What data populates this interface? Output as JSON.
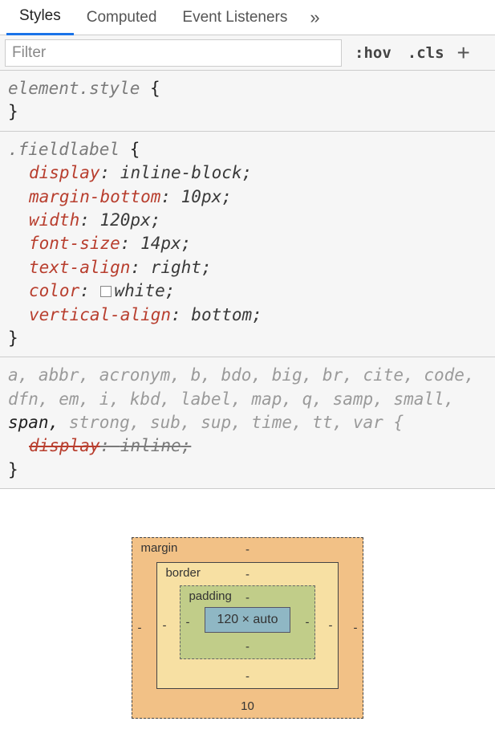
{
  "tabs": {
    "styles": "Styles",
    "computed": "Computed",
    "listeners": "Event Listeners"
  },
  "toolbar": {
    "filter_placeholder": "Filter",
    "hov": ":hov",
    "cls": ".cls"
  },
  "overflow_glyph": "»",
  "rule_element_style": {
    "selector": "element.style",
    "open": " {",
    "close": "}"
  },
  "rule_fieldlabel": {
    "selector": ".fieldlabel",
    "open": " {",
    "close": "}",
    "decls": [
      {
        "prop": "display",
        "val": "inline-block"
      },
      {
        "prop": "margin-bottom",
        "val": "10px"
      },
      {
        "prop": "width",
        "val": "120px"
      },
      {
        "prop": "font-size",
        "val": "14px"
      },
      {
        "prop": "text-align",
        "val": "right"
      },
      {
        "prop": "color",
        "val": "white",
        "swatch": true
      },
      {
        "prop": "vertical-align",
        "val": "bottom"
      }
    ]
  },
  "rule_ua": {
    "selectors_pre": "a, abbr, acronym, b, bdo, big, br, cite, code, dfn, em, i, kbd, label, map, q, samp, small, ",
    "matched": "span,",
    "selectors_post": " strong, sub, sup, time, tt, var {",
    "decl": {
      "prop": "display",
      "val": "inline"
    },
    "close": "}"
  },
  "box_model": {
    "labels": {
      "margin": "margin",
      "border": "border",
      "padding": "padding"
    },
    "margin": {
      "top": "-",
      "right": "-",
      "bottom": "10",
      "left": "-"
    },
    "border": {
      "top": "-",
      "right": "-",
      "bottom": "-",
      "left": "-"
    },
    "padding": {
      "top": "-",
      "right": "-",
      "bottom": "-",
      "left": "-"
    },
    "content": "120 × auto"
  }
}
